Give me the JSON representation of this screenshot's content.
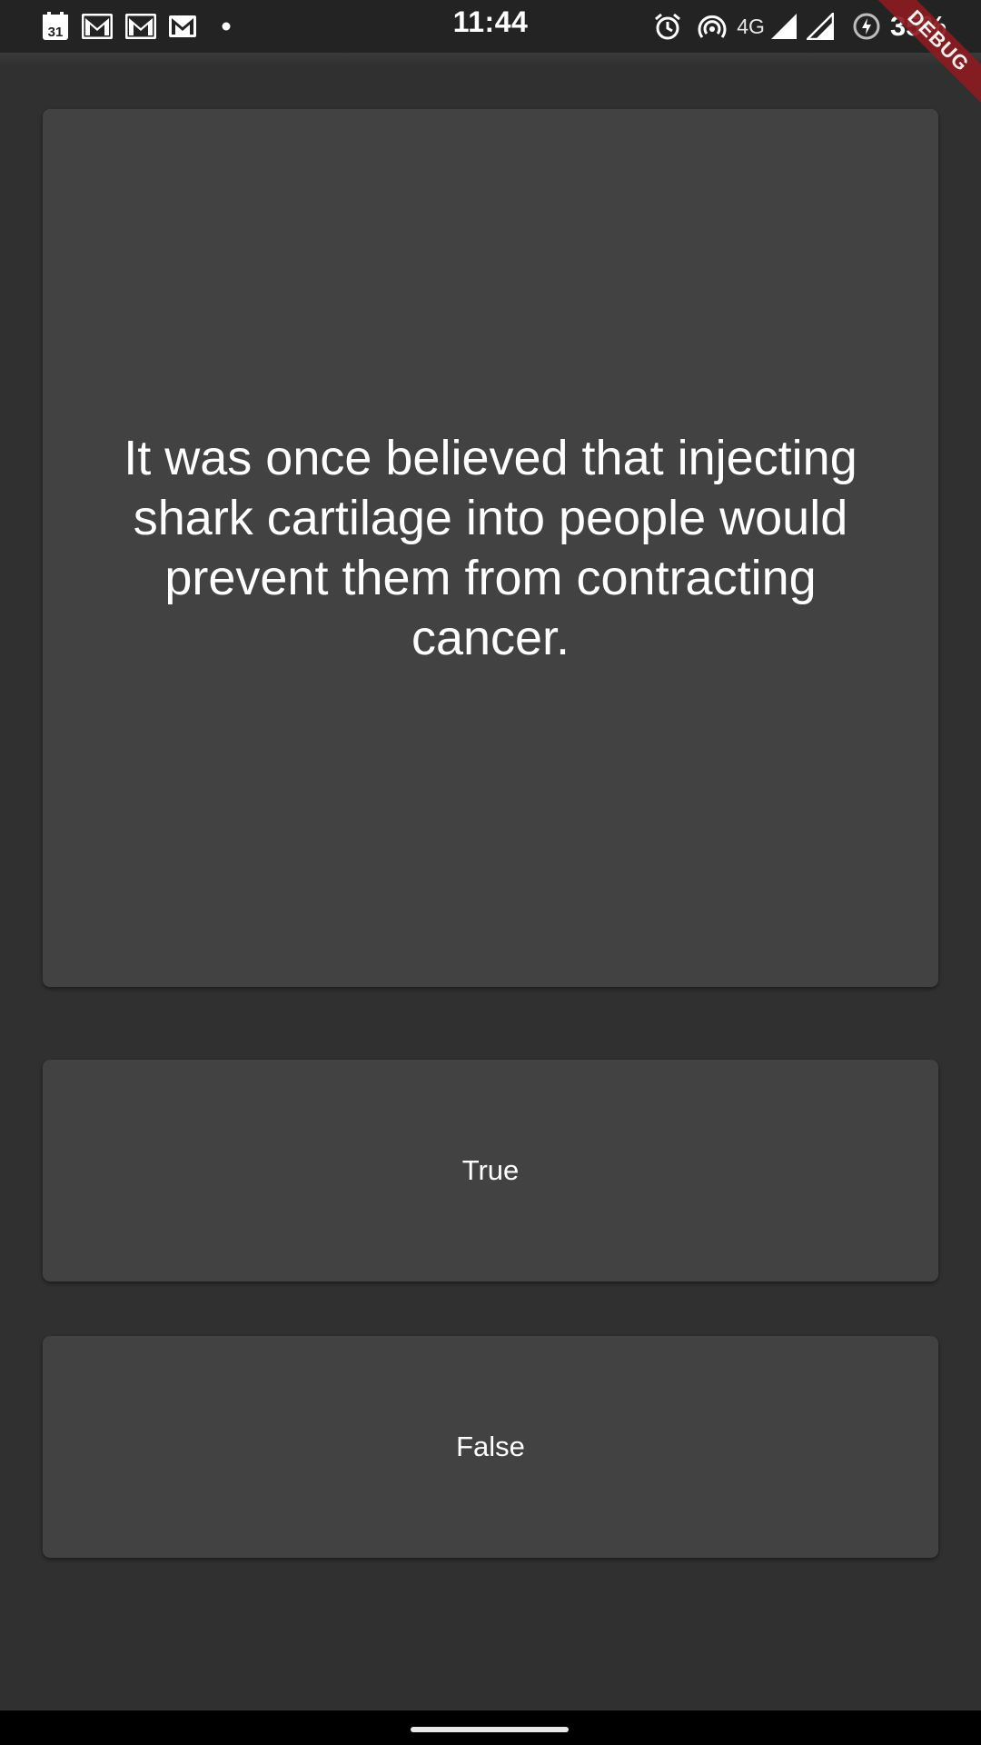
{
  "status_bar": {
    "time": "11:44",
    "network_type": "4G",
    "battery_percent": "35%",
    "calendar_day": "31",
    "notification_icons": [
      "calendar-icon",
      "gmail-icon",
      "gmail-icon",
      "gmail-icon",
      "dot-icon"
    ],
    "system_icons": [
      "alarm-icon",
      "hotspot-icon",
      "signal-icon",
      "signal-icon",
      "battery-saver-icon"
    ]
  },
  "debug_banner": {
    "label": "DEBUG",
    "color": "#8b1c21"
  },
  "quiz": {
    "question": "It was once believed that injecting shark cartilage into people would prevent them from contracting cancer.",
    "answers": {
      "true_label": "True",
      "false_label": "False"
    }
  },
  "colors": {
    "background": "#303030",
    "card": "#424242",
    "text": "#ffffff"
  }
}
